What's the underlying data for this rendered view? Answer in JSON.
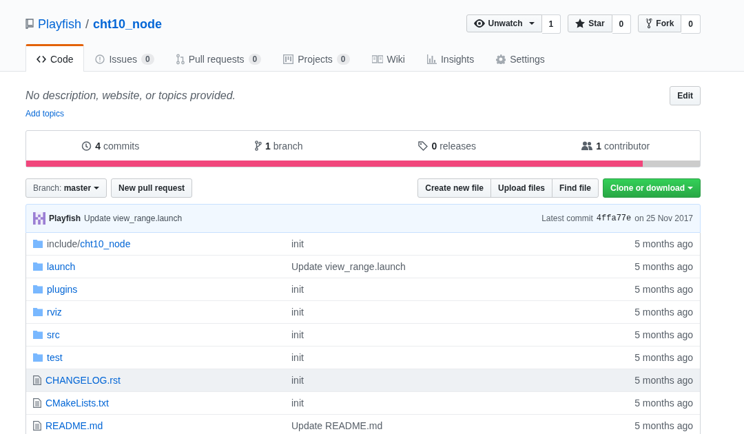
{
  "repo": {
    "owner": "Playfish",
    "separator": "/",
    "name": "cht10_node"
  },
  "actions": [
    {
      "kind": "watch",
      "label": "Unwatch",
      "count": "1"
    },
    {
      "kind": "star",
      "label": "Star",
      "count": "0"
    },
    {
      "kind": "fork",
      "label": "Fork",
      "count": "0"
    }
  ],
  "tabs": [
    {
      "kind": "code",
      "label": "Code",
      "selected": true
    },
    {
      "kind": "issues",
      "label": "Issues",
      "count": "0",
      "selected": false
    },
    {
      "kind": "pulls",
      "label": "Pull requests",
      "count": "0",
      "selected": false
    },
    {
      "kind": "projects",
      "label": "Projects",
      "count": "0",
      "selected": false
    },
    {
      "kind": "wiki",
      "label": "Wiki",
      "selected": false
    },
    {
      "kind": "insights",
      "label": "Insights",
      "selected": false
    },
    {
      "kind": "settings",
      "label": "Settings",
      "selected": false
    }
  ],
  "description": {
    "text": "No description, website, or topics provided.",
    "edit_button": "Edit",
    "add_topics": "Add topics"
  },
  "summary": [
    {
      "kind": "commits",
      "count": "4",
      "label": "commits"
    },
    {
      "kind": "branch",
      "count": "1",
      "label": "branch"
    },
    {
      "kind": "releases",
      "count": "0",
      "label": "releases"
    },
    {
      "kind": "contributors",
      "count": "1",
      "label": "contributor"
    }
  ],
  "language_bar": [
    {
      "color": "#f1467c",
      "level": 0.915
    },
    {
      "color": "#cccccc",
      "level": 0.085
    }
  ],
  "branch_select": {
    "label": "Branch:",
    "value": "master"
  },
  "new_pull_request": "New pull request",
  "file_buttons": [
    "Create new file",
    "Upload files",
    "Find file"
  ],
  "clone_button": "Clone or download",
  "latest_commit": {
    "author": "Playfish",
    "message": "Update view_range.launch",
    "prefix": "Latest commit",
    "sha": "4ffa77e",
    "date": "on 25 Nov 2017"
  },
  "files": [
    {
      "kind": "folder",
      "path_prefix": "include/",
      "name": "cht10_node",
      "message": "init",
      "age": "5 months ago",
      "highlighted": false
    },
    {
      "kind": "folder",
      "name": "launch",
      "message": "Update view_range.launch",
      "age": "5 months ago",
      "highlighted": false
    },
    {
      "kind": "folder",
      "name": "plugins",
      "message": "init",
      "age": "5 months ago",
      "highlighted": false
    },
    {
      "kind": "folder",
      "name": "rviz",
      "message": "init",
      "age": "5 months ago",
      "highlighted": false
    },
    {
      "kind": "folder",
      "name": "src",
      "message": "init",
      "age": "5 months ago",
      "highlighted": false
    },
    {
      "kind": "folder",
      "name": "test",
      "message": "init",
      "age": "5 months ago",
      "highlighted": false
    },
    {
      "kind": "file",
      "name": "CHANGELOG.rst",
      "message": "init",
      "age": "5 months ago",
      "highlighted": true
    },
    {
      "kind": "file",
      "name": "CMakeLists.txt",
      "message": "init",
      "age": "5 months ago",
      "highlighted": false
    },
    {
      "kind": "file",
      "name": "README.md",
      "message": "Update README.md",
      "age": "5 months ago",
      "highlighted": false
    }
  ]
}
